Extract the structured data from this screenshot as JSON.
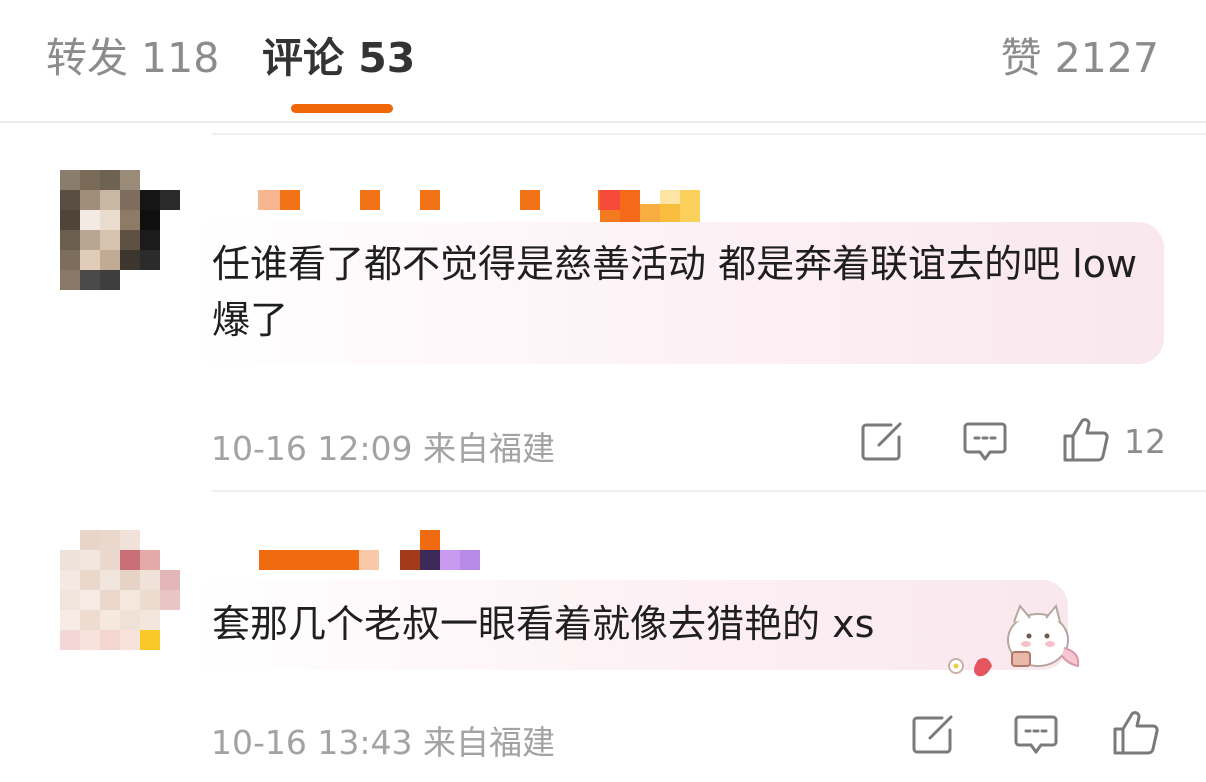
{
  "tabs": {
    "reposts": "转发 118",
    "comments": "评论 53",
    "likes": "赞 2127"
  },
  "comments": [
    {
      "text": "任谁看了都不觉得是慈善活动 都是奔着联谊去的吧 low爆了",
      "time": "10-16 12:09",
      "location": "来自福建",
      "likes": "12"
    },
    {
      "text": "套那几个老叔一眼看着就像去猎艳的 xs",
      "time": "10-16 13:43",
      "location": "来自福建",
      "likes": ""
    }
  ],
  "icons": {
    "share": "share-icon",
    "comment": "comment-icon",
    "like": "thumbs-up-icon"
  },
  "colors": {
    "accent": "#f0670a",
    "text": "#1f1f1f",
    "meta": "#a3a3a3"
  }
}
